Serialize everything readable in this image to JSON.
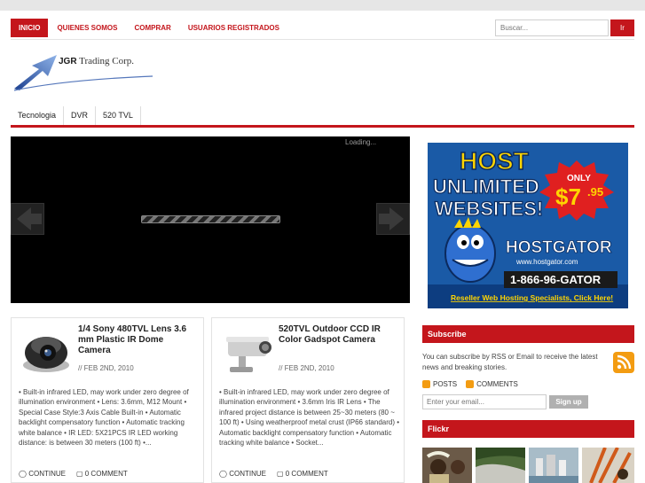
{
  "top_nav": {
    "items": [
      "INICIO",
      "QUIENES SOMOS",
      "COMPRAR",
      "USUARIOS REGISTRADOS"
    ]
  },
  "search": {
    "placeholder": "Buscar...",
    "button": "Ir"
  },
  "logo": {
    "bold": "JGR",
    "rest": "Trading Corp."
  },
  "category_nav": {
    "items": [
      "Tecnologia",
      "DVR",
      "520 TVL"
    ]
  },
  "slider": {
    "loading": "Loading..."
  },
  "posts": [
    {
      "title": "1/4 Sony 480TVL Lens 3.6 mm Plastic IR Dome Camera",
      "date": "// FEB 2ND, 2010",
      "excerpt": "• Built-in infrared LED, may work under zero degree of illumination environment • Lens: 3.6mm, M12 Mount • Special Case Style:3 Axis Cable Built-in • Automatic backlight compensatory function • Automatic tracking white balance • IR LED:  5X21PCS IR LED working distance: is between 30 meters (100 ft) •...",
      "continue": "CONTINUE",
      "comments": "0 COMMENT"
    },
    {
      "title": "520TVL Outdoor CCD IR Color Gadspot Camera",
      "date": "// FEB 2ND, 2010",
      "excerpt": "• Built-in infrared LED, may work under zero degree of illumination environment • 3.6mm Iris IR Lens • The infrared project distance is between 25~30 meters (80 ~ 100 ft) • Using weatherproof metal crust (IP66 standard) • Automatic backlight compensatory function • Automatic tracking white balance • Socket...",
      "continue": "CONTINUE",
      "comments": "0 COMMENT"
    }
  ],
  "ad": {
    "line1": "HOST",
    "line2": "UNLIMITED",
    "line3": "WEBSITES!",
    "only": "ONLY",
    "price": "$7",
    "cents": ".95",
    "brand": "HOSTGATOR",
    "url": "www.hostgator.com",
    "phone": "1-866-96-GATOR",
    "tagline": "Reseller Web Hosting Specialists, Click Here!"
  },
  "subscribe": {
    "heading": "Subscribe",
    "text": "You can subscribe by RSS or Email to receive the latest news and breaking stories.",
    "posts_link": "POSTS",
    "comments_link": "COMMENTS",
    "email_placeholder": "Enter your email...",
    "signup": "Sign up"
  },
  "flickr": {
    "heading": "Flickr"
  },
  "colors": {
    "accent": "#c4161c",
    "ad_blue": "#1a5aa6",
    "ad_yellow": "#ffd500"
  }
}
